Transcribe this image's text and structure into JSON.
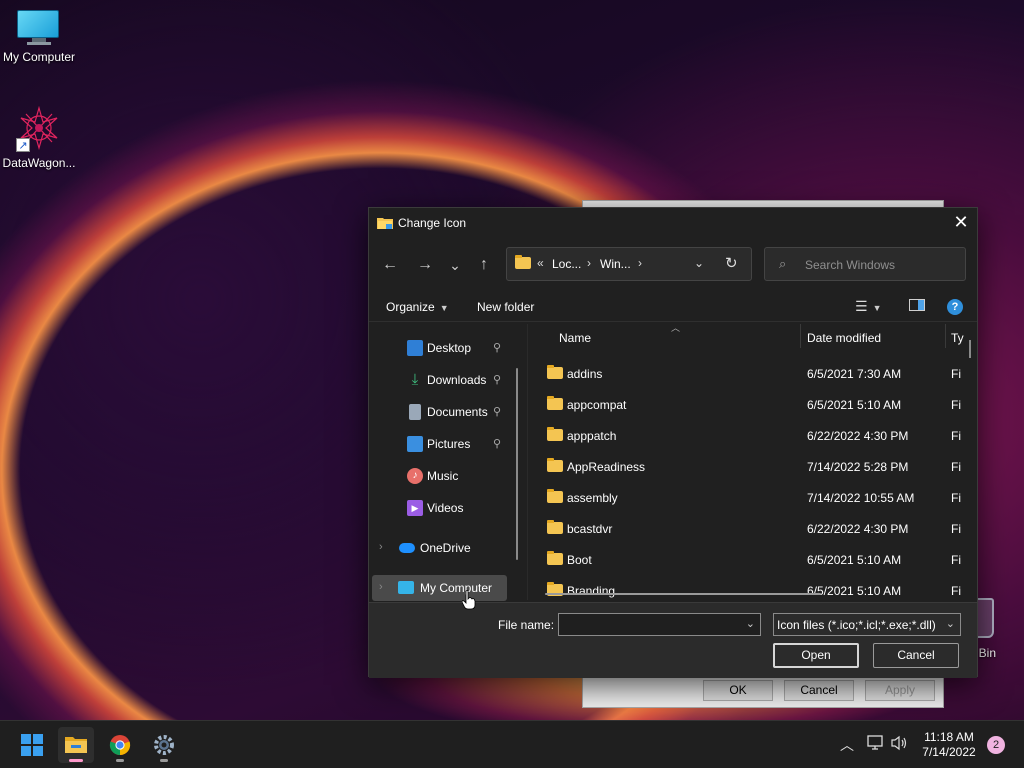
{
  "desktop": {
    "icons": [
      {
        "label": "My Computer",
        "icon": "monitor-icon"
      },
      {
        "label": "DataWagon...",
        "icon": "datawagon-icon"
      }
    ],
    "recycle_label": "le Bin"
  },
  "background_dialog": {
    "ok": "OK",
    "cancel": "Cancel",
    "apply": "Apply"
  },
  "dialog": {
    "title": "Change Icon",
    "close_glyph": "✕",
    "nav": {
      "back": "←",
      "forward": "→",
      "recent": "⌄",
      "up": "↑"
    },
    "address": {
      "prefix": "«",
      "crumbs": [
        "Loc...",
        "Win..."
      ],
      "separator": "›",
      "dropdown": "⌄",
      "refresh": "↻"
    },
    "search": {
      "placeholder": "Search Windows",
      "icon": "⌕"
    },
    "toolbar": {
      "organize": "Organize",
      "new_folder": "New folder",
      "help": "?"
    },
    "nav_pane": {
      "items": [
        {
          "label": "Desktop",
          "icon": "desktop-icon",
          "pinned": true,
          "color": "#2f7fd6"
        },
        {
          "label": "Downloads",
          "icon": "downloads-icon",
          "pinned": true,
          "color": "#3fbf7f"
        },
        {
          "label": "Documents",
          "icon": "documents-icon",
          "pinned": true,
          "color": "#9aa8b8"
        },
        {
          "label": "Pictures",
          "icon": "pictures-icon",
          "pinned": true,
          "color": "#3a8fe0"
        },
        {
          "label": "Music",
          "icon": "music-icon",
          "pinned": false,
          "color": "#e8706a"
        },
        {
          "label": "Videos",
          "icon": "videos-icon",
          "pinned": false,
          "color": "#9b5de5"
        },
        {
          "label": "OneDrive",
          "icon": "onedrive-icon",
          "pinned": false,
          "color": "#1e90ff"
        },
        {
          "label": "My Computer",
          "icon": "computer-icon",
          "pinned": false,
          "color": "#35b4e8"
        }
      ],
      "pin_glyph": "📌",
      "expand_glyph": "›"
    },
    "columns": {
      "name": "Name",
      "date": "Date modified",
      "type": "Ty"
    },
    "rows": [
      {
        "name": "addins",
        "date": "6/5/2021 7:30 AM",
        "type": "Fi"
      },
      {
        "name": "appcompat",
        "date": "6/5/2021 5:10 AM",
        "type": "Fi"
      },
      {
        "name": "apppatch",
        "date": "6/22/2022 4:30 PM",
        "type": "Fi"
      },
      {
        "name": "AppReadiness",
        "date": "7/14/2022 5:28 PM",
        "type": "Fi"
      },
      {
        "name": "assembly",
        "date": "7/14/2022 10:55 AM",
        "type": "Fi"
      },
      {
        "name": "bcastdvr",
        "date": "6/22/2022 4:30 PM",
        "type": "Fi"
      },
      {
        "name": "Boot",
        "date": "6/5/2021 5:10 AM",
        "type": "Fi"
      },
      {
        "name": "Branding",
        "date": "6/5/2021 5:10 AM",
        "type": "Fi"
      }
    ],
    "file_name": {
      "label": "File name:",
      "value": ""
    },
    "file_type": {
      "value": "Icon files (*.ico;*.icl;*.exe;*.dll)"
    },
    "buttons": {
      "open": "Open",
      "cancel": "Cancel"
    }
  },
  "taskbar": {
    "apps": [
      "start-icon",
      "file-explorer-icon",
      "chrome-icon",
      "settings-icon"
    ],
    "tray": {
      "chevron": "︿",
      "network": "🖧",
      "volume": "🔊"
    },
    "time": "11:18 AM",
    "date": "7/14/2022",
    "notifications": "2"
  }
}
